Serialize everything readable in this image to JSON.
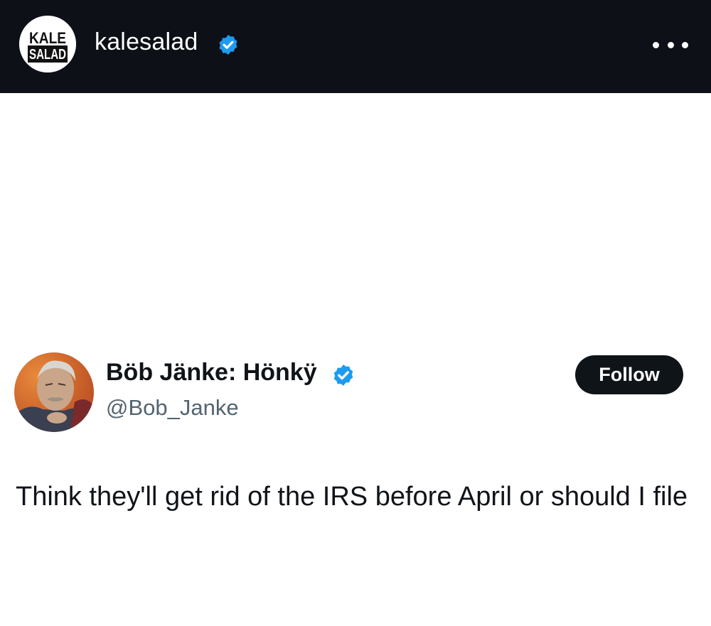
{
  "header": {
    "avatar_logo_text": [
      "KALE",
      "SALAD"
    ],
    "username": "kalesalad",
    "verified_icon": "verified-badge-icon",
    "more_icon": "more-horizontal-icon"
  },
  "tweet": {
    "avatar_icon": "profile-photo",
    "display_name": "Böb Jänke: Hönkÿ",
    "verified_icon": "verified-badge-icon",
    "handle": "@Bob_Janke",
    "follow_label": "Follow",
    "text": "Think they'll get rid of the IRS before April or should I file"
  },
  "colors": {
    "header_bg": "#0d1017",
    "verified_blue": "#1d9bf0",
    "text_primary": "#0f1419",
    "text_secondary": "#536471"
  }
}
